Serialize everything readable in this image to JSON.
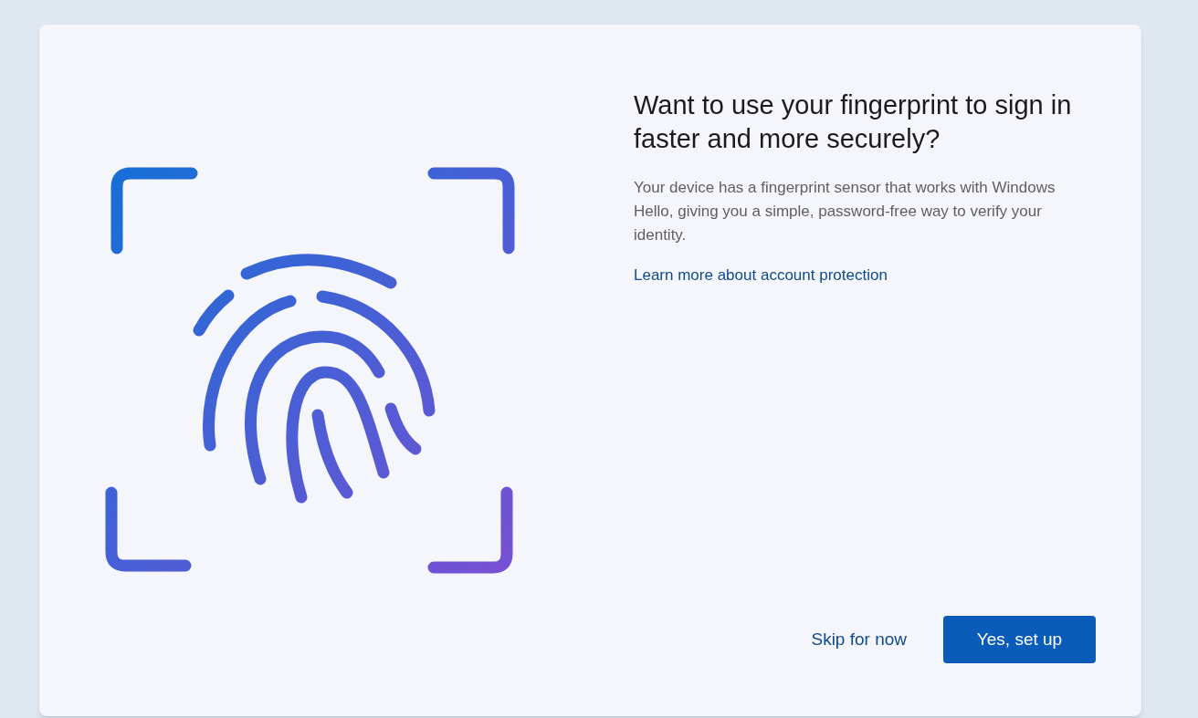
{
  "dialog": {
    "title": "Want to use your fingerprint to sign in faster and more securely?",
    "description": "Your device has a fingerprint sensor that works with Windows Hello, giving you a simple, password-free way to verify your identity.",
    "link": "Learn more about account protection",
    "buttons": [
      {
        "label": "Skip for now",
        "kind": "secondary"
      },
      {
        "label": "Yes, set up",
        "kind": "primary"
      }
    ]
  }
}
